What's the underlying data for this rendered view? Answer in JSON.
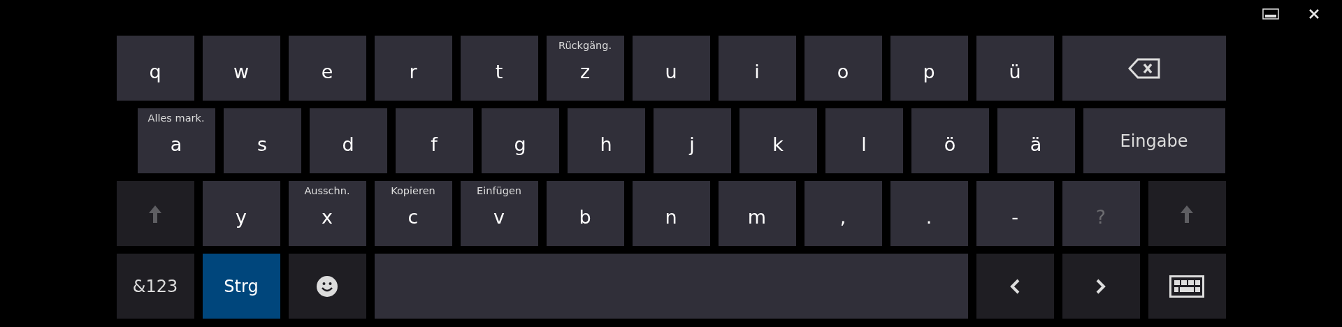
{
  "rows": [
    [
      {
        "kind": "letter",
        "label": "q",
        "disabled": false
      },
      {
        "kind": "letter",
        "label": "w",
        "disabled": false
      },
      {
        "kind": "letter",
        "label": "e",
        "disabled": false
      },
      {
        "kind": "letter",
        "label": "r",
        "disabled": false
      },
      {
        "kind": "letter",
        "label": "t",
        "disabled": false
      },
      {
        "kind": "letter",
        "label": "z",
        "hint": "Rückgäng.",
        "disabled": false
      },
      {
        "kind": "letter",
        "label": "u",
        "disabled": false
      },
      {
        "kind": "letter",
        "label": "i",
        "disabled": false
      },
      {
        "kind": "letter",
        "label": "o",
        "disabled": false
      },
      {
        "kind": "letter",
        "label": "p",
        "disabled": false
      },
      {
        "kind": "letter",
        "label": "ü",
        "disabled": false
      },
      {
        "kind": "backspace",
        "disabled": false
      }
    ],
    [
      {
        "kind": "letter",
        "label": "a",
        "hint": "Alles mark.",
        "disabled": false
      },
      {
        "kind": "letter",
        "label": "s",
        "disabled": false
      },
      {
        "kind": "letter",
        "label": "d",
        "disabled": false
      },
      {
        "kind": "letter",
        "label": "f",
        "disabled": false
      },
      {
        "kind": "letter",
        "label": "g",
        "disabled": false
      },
      {
        "kind": "letter",
        "label": "h",
        "disabled": false
      },
      {
        "kind": "letter",
        "label": "j",
        "disabled": false
      },
      {
        "kind": "letter",
        "label": "k",
        "disabled": false
      },
      {
        "kind": "letter",
        "label": "l",
        "disabled": false
      },
      {
        "kind": "letter",
        "label": "ö",
        "disabled": false
      },
      {
        "kind": "letter",
        "label": "ä",
        "disabled": false
      },
      {
        "kind": "enter",
        "label": "Eingabe",
        "disabled": false
      }
    ],
    [
      {
        "kind": "shift",
        "on": false,
        "disabled": false
      },
      {
        "kind": "letter",
        "label": "y",
        "disabled": false
      },
      {
        "kind": "letter",
        "label": "x",
        "hint": "Ausschn.",
        "disabled": false
      },
      {
        "kind": "letter",
        "label": "c",
        "hint": "Kopieren",
        "disabled": false
      },
      {
        "kind": "letter",
        "label": "v",
        "hint": "Einfügen",
        "disabled": false
      },
      {
        "kind": "letter",
        "label": "b",
        "disabled": false
      },
      {
        "kind": "letter",
        "label": "n",
        "disabled": false
      },
      {
        "kind": "letter",
        "label": "m",
        "disabled": false
      },
      {
        "kind": "letter",
        "label": ",",
        "disabled": false
      },
      {
        "kind": "letter",
        "label": ".",
        "disabled": false
      },
      {
        "kind": "letter",
        "label": "-",
        "disabled": false
      },
      {
        "kind": "letter",
        "label": "?",
        "disabled": true
      },
      {
        "kind": "shift",
        "on": false,
        "disabled": false
      }
    ],
    [
      {
        "kind": "symbols",
        "label": "&123",
        "disabled": false
      },
      {
        "kind": "ctrl",
        "label": "Strg",
        "on": true,
        "disabled": false
      },
      {
        "kind": "emoji",
        "disabled": false
      },
      {
        "kind": "space",
        "disabled": false
      },
      {
        "kind": "left",
        "disabled": false
      },
      {
        "kind": "right",
        "disabled": false
      },
      {
        "kind": "keyboard",
        "disabled": false
      }
    ]
  ]
}
